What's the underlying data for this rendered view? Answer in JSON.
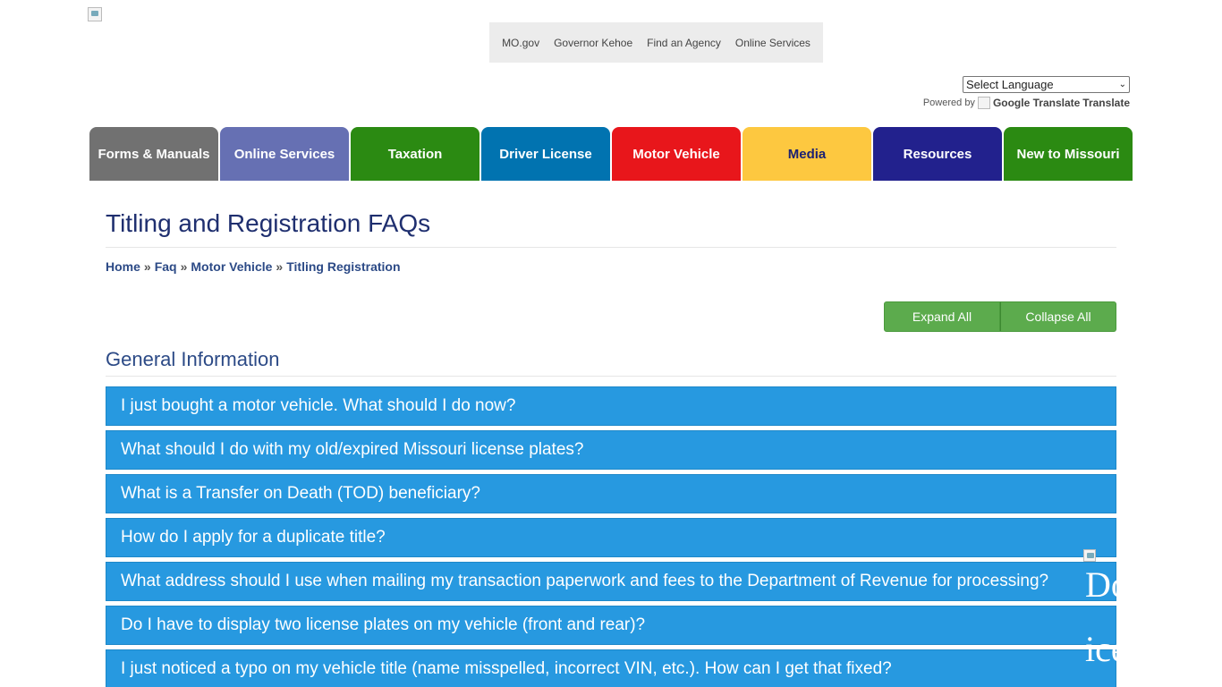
{
  "top_links": [
    "MO.gov",
    "Governor Kehoe",
    "Find an Agency",
    "Online Services"
  ],
  "language": {
    "selected": "Select Language",
    "powered_by": "Powered by",
    "google_translate": "Google Translate",
    "translate": "Translate"
  },
  "nav": [
    {
      "label": "Forms & Manuals",
      "color": "#717171",
      "text_color": "#ffffff"
    },
    {
      "label": "Online Services",
      "color": "#6670b3",
      "text_color": "#ffffff"
    },
    {
      "label": "Taxation",
      "color": "#2b8a12",
      "text_color": "#ffffff"
    },
    {
      "label": "Driver License",
      "color": "#0173b0",
      "text_color": "#ffffff"
    },
    {
      "label": "Motor Vehicle",
      "color": "#e8161b",
      "text_color": "#ffffff"
    },
    {
      "label": "Media",
      "color": "#fdc840",
      "text_color": "#1b2173"
    },
    {
      "label": "Resources",
      "color": "#22218d",
      "text_color": "#ffffff"
    },
    {
      "label": "New to Missouri",
      "color": "#2b8a12",
      "text_color": "#ffffff"
    }
  ],
  "page": {
    "title": "Titling and Registration FAQs"
  },
  "breadcrumb": [
    "Home",
    "Faq",
    "Motor Vehicle",
    "Titling Registration"
  ],
  "actions": {
    "expand_all": "Expand All",
    "collapse_all": "Collapse All"
  },
  "section": {
    "heading": "General Information"
  },
  "faqs": [
    "I just bought a motor vehicle. What should I do now?",
    "What should I do with my old/expired Missouri license plates?",
    "What is a Transfer on Death (TOD) beneficiary?",
    "How do I apply for a duplicate title?",
    "What address should I use when mailing my transaction paperwork and fees to the Department of Revenue for processing?",
    "Do I have to display two license plates on my vehicle (front and rear)?",
    "I just noticed a typo on my vehicle title (name misspelled, incorrect VIN, etc.). How can I get that fixed?"
  ],
  "chat_widget": {
    "line1": "Do",
    "line2": "ice"
  },
  "colors": {
    "faq_bg": "#2799e0",
    "title": "#1f2f6f",
    "button": "#5cab4d"
  }
}
